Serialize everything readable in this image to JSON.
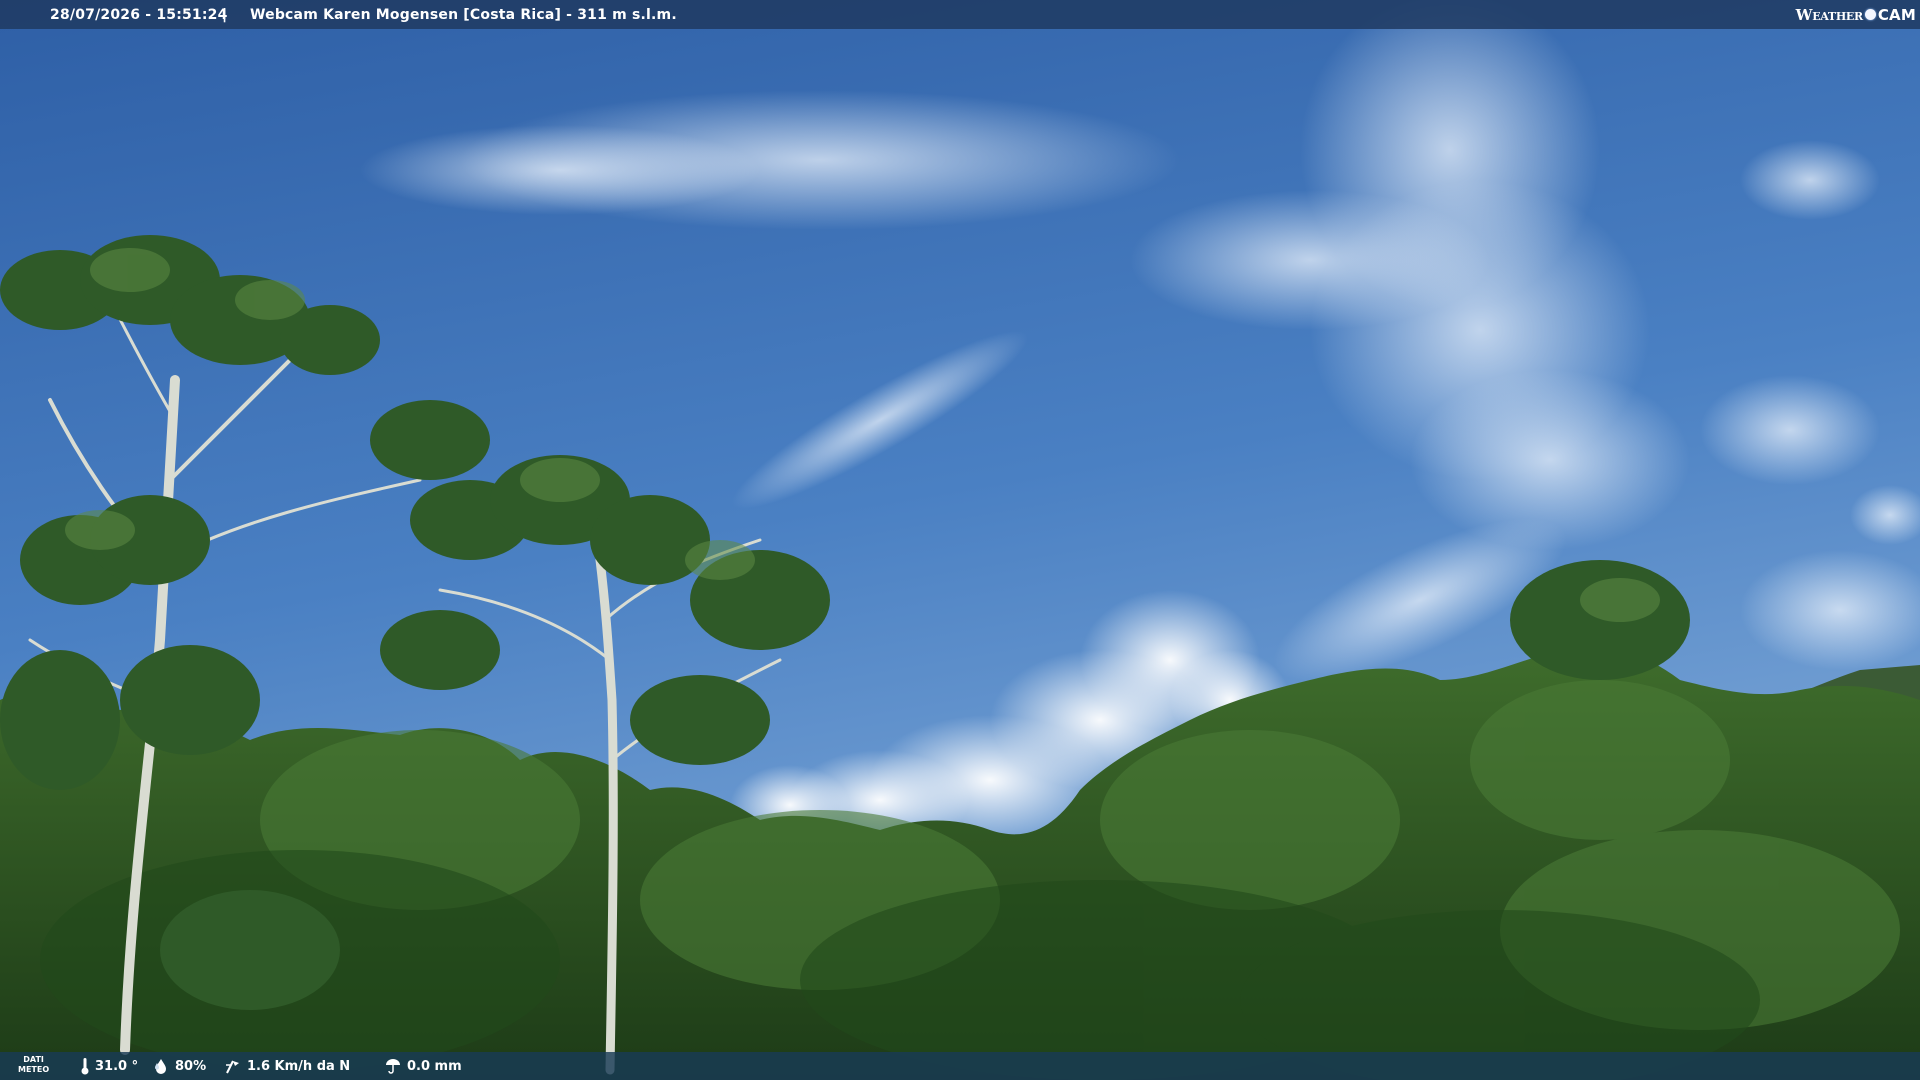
{
  "overlay": {
    "timestamp": "28/07/2026 - 15:51:24",
    "separator": "|",
    "title": "Webcam Karen Mogensen [Costa Rica]  - 311 m s.l.m.",
    "brand_weather": "Weather",
    "brand_cam": "CAM"
  },
  "weather": {
    "label_line1": "DATI",
    "label_line2": "METEO",
    "temperature": "31.0 °",
    "humidity": "80%",
    "wind": "1.6 Km/h da N",
    "rain": "0.0 mm"
  },
  "icons": [
    "thermometer-icon",
    "humidity-icon",
    "wind-icon",
    "rain-icon"
  ],
  "colors": {
    "sky": "#3f72b6",
    "foliage": "#2f5a24",
    "bar": "#1f3a62"
  }
}
